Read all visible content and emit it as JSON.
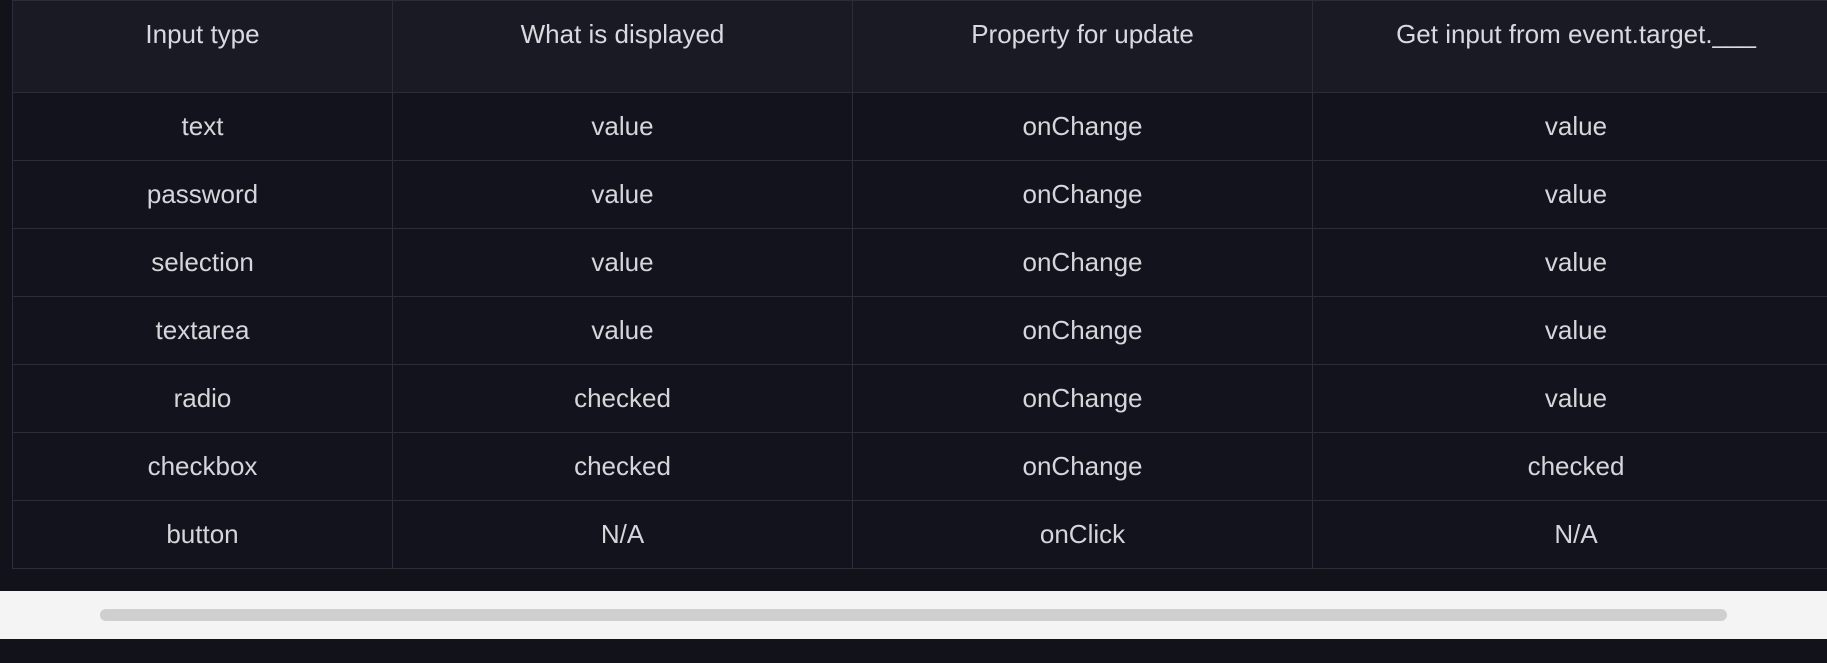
{
  "table": {
    "headers": [
      "Input type",
      "What is displayed",
      "Property for update",
      "Get input from event.target.___"
    ],
    "rows": [
      [
        "text",
        "value",
        "onChange",
        "value"
      ],
      [
        "password",
        "value",
        "onChange",
        "value"
      ],
      [
        "selection",
        "value",
        "onChange",
        "value"
      ],
      [
        "textarea",
        "value",
        "onChange",
        "value"
      ],
      [
        "radio",
        "checked",
        "onChange",
        "value"
      ],
      [
        "checkbox",
        "checked",
        "onChange",
        "checked"
      ],
      [
        "button",
        "N/A",
        "onClick",
        "N/A"
      ]
    ]
  }
}
